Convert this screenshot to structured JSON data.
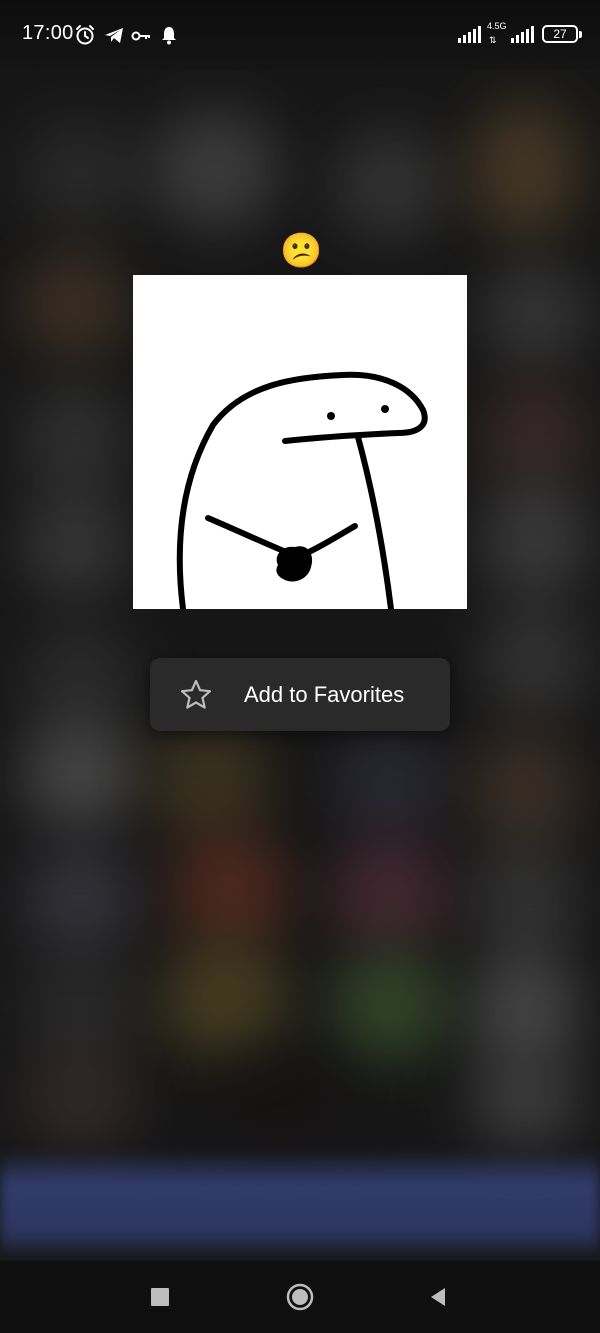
{
  "status_bar": {
    "time": "17:00",
    "network_type": "4.5G",
    "battery_level": "27",
    "icons": [
      "alarm-icon",
      "telegram-icon",
      "vpn-key-icon",
      "notification-bell-icon",
      "signal-icon",
      "signal-4g-icon",
      "battery-icon"
    ]
  },
  "sticker_preview": {
    "emoji": "😕",
    "image_icon": "flork-sticker"
  },
  "context_menu": {
    "items": [
      {
        "label": "Add to Favorites",
        "icon": "star-outline-icon"
      }
    ]
  },
  "nav_bar": {
    "buttons": [
      "recents-square-icon",
      "home-circle-icon",
      "back-triangle-icon"
    ]
  },
  "colors": {
    "menu_background": "#2a2a2a",
    "menu_text": "#ffffff",
    "sticker_background": "#ffffff",
    "navbar_background": "#0f0f0f"
  }
}
